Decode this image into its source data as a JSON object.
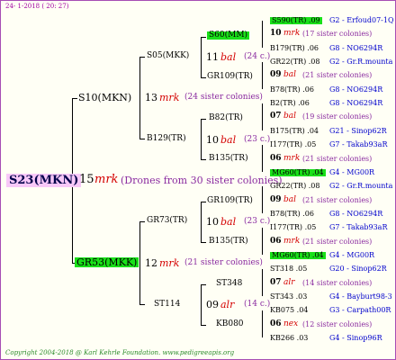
{
  "header": "24- 1-2018 ( 20: 27)",
  "footer": "Copyright 2004-2018 @ Karl Kehrle Foundation.   www.pedigreeapis.org",
  "root": {
    "name": "S23(MKN)",
    "num": "15",
    "brand": "mrk",
    "note": "(Drones from 30 sister colonies)"
  },
  "gen1": {
    "sire": {
      "name": "S10(MKN)",
      "num": "13",
      "brand": "mrk",
      "note": "(24 sister colonies)"
    },
    "dam": {
      "name": "GR53(MKK)",
      "num": "12",
      "brand": "mrk",
      "note": "(21 sister colonies)"
    }
  },
  "gen2": {
    "ss": {
      "name": "S05(MKK)",
      "num": "11",
      "brand": "bal",
      "note": "(24 c.)"
    },
    "sd": {
      "name": "B129(TR)",
      "num": "10",
      "brand": "bal",
      "note": "(23 c.)"
    },
    "ds": {
      "name": "GR73(TR)",
      "num": "10",
      "brand": "bal",
      "note": "(23 c.)"
    },
    "dd": {
      "name": "ST114",
      "num": "09",
      "brand": "alr",
      "note": "(14 c.)"
    }
  },
  "gen3": {
    "a": {
      "name": "S60(MM)"
    },
    "b": {
      "name": "GR109(TR)"
    },
    "c": {
      "name": "B82(TR)"
    },
    "d": {
      "name": "B135(TR)"
    },
    "e": {
      "name": "GR109(TR)"
    },
    "f": {
      "name": "B135(TR)"
    },
    "g": {
      "name": "ST348"
    },
    "h": {
      "name": "KB080"
    }
  },
  "gen4": [
    {
      "id": "S590(TR) .09",
      "origin": "G2 - Erfoud07-1Q",
      "green": true
    },
    {
      "num": "10",
      "brand": "mrk",
      "note": "(17 sister colonies)"
    },
    {
      "id": "B179(TR) .06",
      "origin": "G8 - NO6294R"
    },
    {
      "id": "GR22(TR) .08",
      "origin": "G2 - Gr.R.mounta"
    },
    {
      "num": "09",
      "brand": "bal",
      "note": "(21 sister colonies)"
    },
    {
      "id": "B78(TR) .06",
      "origin": "G8 - NO6294R"
    },
    {
      "id": "B2(TR) .06",
      "origin": "G8 - NO6294R"
    },
    {
      "num": "07",
      "brand": "bal",
      "note": "(19 sister colonies)"
    },
    {
      "id": "B175(TR) .04",
      "origin": "G21 - Sinop62R"
    },
    {
      "id": "I177(TR) .05",
      "origin": "G7 - Takab93aR"
    },
    {
      "num": "06",
      "brand": "mrk",
      "note": "(21 sister colonies)"
    },
    {
      "id": "MG60(TR) .04",
      "origin": "G4 - MG00R",
      "green": true
    },
    {
      "id": "GR22(TR) .08",
      "origin": "G2 - Gr.R.mounta"
    },
    {
      "num": "09",
      "brand": "bal",
      "note": "(21 sister colonies)"
    },
    {
      "id": "B78(TR) .06",
      "origin": "G8 - NO6294R"
    },
    {
      "id": "I177(TR) .05",
      "origin": "G7 - Takab93aR"
    },
    {
      "num": "06",
      "brand": "mrk",
      "note": "(21 sister colonies)"
    },
    {
      "id": "MG60(TR) .04",
      "origin": "G4 - MG00R",
      "green": true
    },
    {
      "id": "ST318 .05",
      "origin": "G20 - Sinop62R"
    },
    {
      "num": "07",
      "brand": "alr",
      "note": "(14 sister colonies)"
    },
    {
      "id": "ST343 .03",
      "origin": "G4 - Bayburt98-3"
    },
    {
      "id": "KB075 .04",
      "origin": "G3 - Carpath00R"
    },
    {
      "num": "06",
      "brand": "nex",
      "note": "(12 sister colonies)"
    },
    {
      "id": "KB266 .03",
      "origin": "G4 - Sinop96R"
    }
  ]
}
